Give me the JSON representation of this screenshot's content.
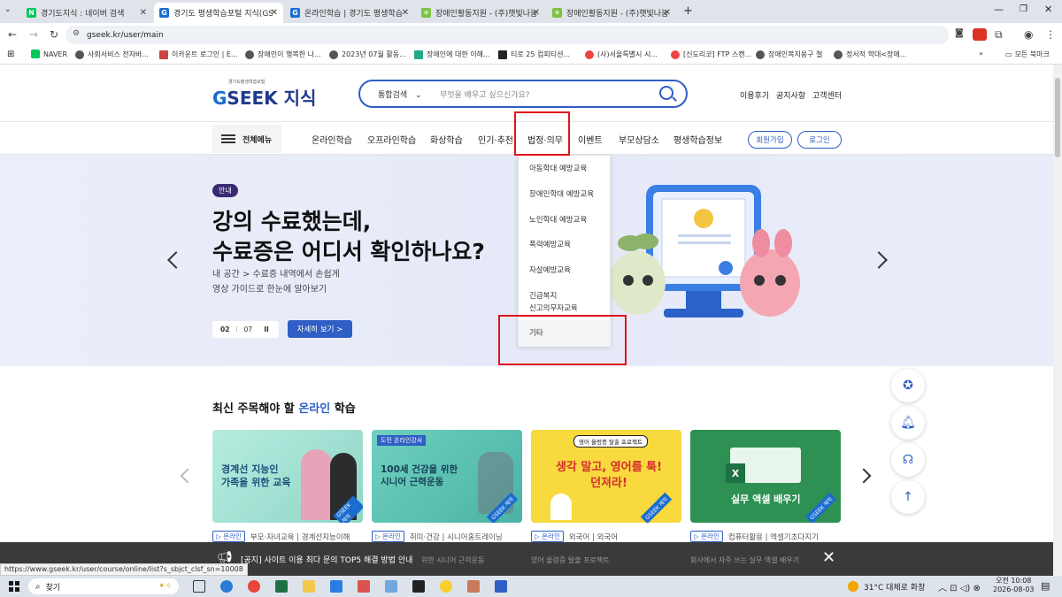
{
  "browser": {
    "tabs": [
      {
        "title": "경기도지식 : 네이버 검색",
        "favicon_color": "#03c75a",
        "favicon_text": "N"
      },
      {
        "title": "경기도 평생학습포털 지식(GSE",
        "favicon_color": "#1a6ccf",
        "favicon_text": "G"
      },
      {
        "title": "온라인학습 | 경기도 평생학습",
        "favicon_color": "#1a6ccf",
        "favicon_text": "G"
      },
      {
        "title": "장애인활동지원 - (주)햇빛나눔",
        "favicon_color": "#7cc242",
        "favicon_text": "☀"
      },
      {
        "title": "장애인활동지원 - (주)햇빛나눔",
        "favicon_color": "#7cc242",
        "favicon_text": "☀"
      }
    ],
    "new_tab": "+",
    "url": "gseek.kr/user/main",
    "bookmarks": [
      "NAVER",
      "사회서비스 전자바...",
      "이카운트 로그인 | E...",
      "장애인이 행복한 나...",
      "2023년 07월 활동...",
      "장애인에 대한 이해...",
      "티로 25 컴피티션...",
      "(사)서울특별시 시...",
      "[신도리코] FTP 스캔...",
      "장애인복지용구 철",
      "정서적 학대<장애..."
    ],
    "bookmarks_more": "»",
    "all_bookmarks": "모든 북마크"
  },
  "site": {
    "logo_small": "경기도평생학습포털",
    "logo_main": "SEEK 지식",
    "logo_g": "G",
    "search": {
      "category": "통합검색",
      "placeholder": "무엇을 배우고 싶으신가요?"
    },
    "top_links": [
      "이용후기",
      "공지사항",
      "고객센터"
    ],
    "all_menu": "전체메뉴",
    "nav": [
      "온라인학습",
      "오프라인학습",
      "화상학습",
      "인기·추천",
      "법정·의무",
      "이벤트",
      "부모상담소",
      "평생학습정보"
    ],
    "join": "회원가입",
    "login": "로그인"
  },
  "dropdown": {
    "items": [
      "아동학대 예방교육",
      "장애인학대 예방교육",
      "노인학대 예방교육",
      "폭력예방교육",
      "자살예방교육",
      "긴급복지\n신고의무자교육",
      "기타"
    ]
  },
  "hero": {
    "badge": "안내",
    "title1": "강의 수료했는데,",
    "title2": "수료증은 어디서 확인하나요?",
    "sub1": "내 공간 > 수료증 내역에서 손쉽게",
    "sub2": "영상 가이드로 한눈에 알아보기",
    "pager_current": "02",
    "pager_sep": "I",
    "pager_total": "07",
    "pager_pause": "II",
    "detail_button": "자세히 보기  >"
  },
  "section": {
    "title_pre": "최신 주목해야 할 ",
    "title_accent": "온라인",
    "title_post": " 학습"
  },
  "cards": [
    {
      "image_text": "경계선 지능인\n가족을 위한 교육",
      "tag": "▷ 온라인",
      "meta": "부모·자녀교육 | 경계선지능이해",
      "bg": "#9edfd0"
    },
    {
      "image_text": "100세 건강을 위한\n시니어 근력운동",
      "tag": "▷ 온라인",
      "meta": "취미·건강 | 시니어홈트레이닝",
      "bg": "#5ec3b3",
      "label": "도민 온라인강사"
    },
    {
      "image_text": "생각 말고, 영어를 툭!\n던져라!",
      "tag": "▷ 온라인",
      "meta": "외국어 | 외국어",
      "bg": "#f8d93e",
      "label": "영어 울렁증 탈출 프로젝트"
    },
    {
      "image_text": "실무 엑셀 배우기",
      "tag": "▷ 온라인",
      "meta": "컴퓨터활용 | 엑셀기초다지기",
      "bg": "#2e9153"
    }
  ],
  "gseek_stamp": "GSEEK 제작",
  "notice": {
    "text": "[공지] 사이트 이용 최다 문의 TOP5 해결 방법 안내",
    "behind": [
      "위한 시니어 근력운동",
      "영어 울렁증 탈출 프로젝트",
      "회사에서 자주 쓰는 실무 엑셀 배우기"
    ]
  },
  "status_url": "https://www.gseek.kr/user/course/online/list?s_sbjct_clsf_sn=10008",
  "taskbar": {
    "search": "찾기",
    "weather": "31°C  대체로 화창",
    "time": "오전 10:08",
    "date": "2026-08-03"
  },
  "colors": {
    "accent": "#2f5ec4",
    "highlight": "#e0161e",
    "hero_bg": "#e8ebf8",
    "logo": "#1e3a8a"
  }
}
